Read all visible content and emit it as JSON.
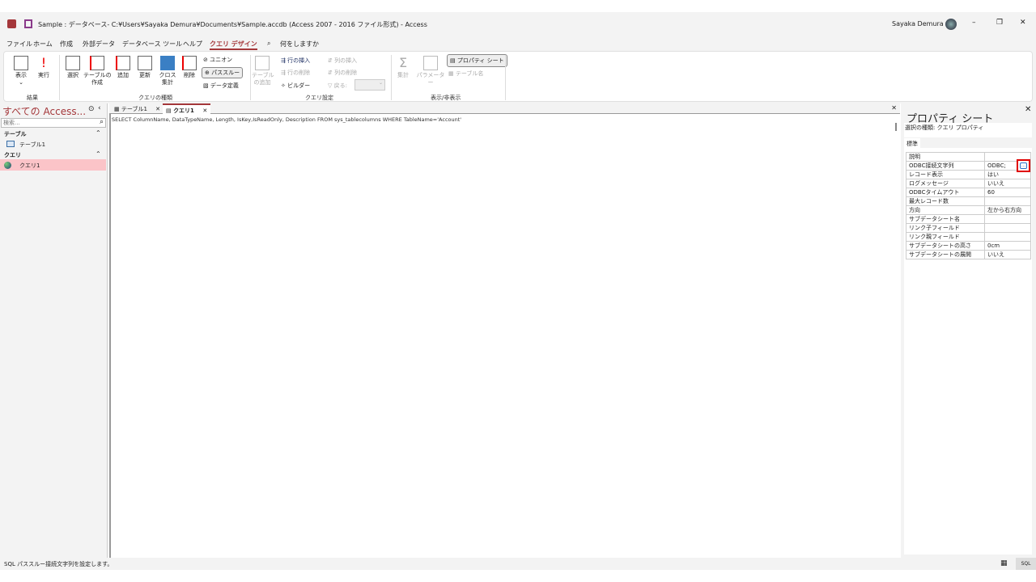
{
  "title_bar": {
    "title": "Sample : データベース- C:¥Users¥Sayaka Demura¥Documents¥Sample.accdb (Access 2007 - 2016 ファイル形式)  -  Access",
    "user": "Sayaka Demura",
    "minimize": "–",
    "restore": "❐",
    "close": "✕"
  },
  "menu": {
    "items": [
      "ファイル",
      "ホーム",
      "作成",
      "外部データ",
      "データベース ツール",
      "ヘルプ",
      "クエリ デザイン"
    ],
    "active": "クエリ デザイン",
    "search": "何をしますか"
  },
  "ribbon": {
    "results": {
      "view": "表示",
      "run": "実行",
      "group": "結果"
    },
    "query_type": {
      "select": "選択",
      "make_table": "テーブルの\n作成",
      "append": "追加",
      "update": "更新",
      "crosstab": "クロス\n集計",
      "delete": "削除",
      "union": "ユニオン",
      "pass_through": "パススルー",
      "data_definition": "データ定義",
      "group": "クエリの種類"
    },
    "query_setup": {
      "add_table": "テーブル\nの追加",
      "insert_rows": "行の挿入",
      "delete_rows": "行の削除",
      "builder": "ビルダー",
      "insert_columns": "列の挿入",
      "delete_columns": "列の削除",
      "return": "戻る:",
      "group": "クエリ設定"
    },
    "show_hide": {
      "totals": "集計",
      "parameters": "パラメーター",
      "property_sheet": "プロパティ シート",
      "table_names": "テーブル名",
      "group": "表示/非表示"
    }
  },
  "nav": {
    "title": "すべての Access...",
    "search_placeholder": "検索...",
    "sections": [
      {
        "label": "テーブル",
        "items": [
          "テーブル1"
        ]
      },
      {
        "label": "クエリ",
        "items": [
          "クエリ1"
        ]
      }
    ]
  },
  "tabs": [
    {
      "label": "テーブル1"
    },
    {
      "label": "クエリ1",
      "active": true
    }
  ],
  "sql": "SELECT ColumnName, DataTypeName, Length, IsKey,IsReadOnly, Description FROM sys_tablecolumns WHERE TableName='Account'",
  "property_sheet": {
    "title": "プロパティ シート",
    "selection_type": "選択の種類:  クエリ プロパティ",
    "tab": "標準",
    "rows": [
      {
        "name": "説明",
        "value": ""
      },
      {
        "name": "ODBC接続文字列",
        "value": "ODBC;"
      },
      {
        "name": "レコード表示",
        "value": "はい"
      },
      {
        "name": "ログメッセージ",
        "value": "いいえ"
      },
      {
        "name": "ODBCタイムアウト",
        "value": "60"
      },
      {
        "name": "最大レコード数",
        "value": ""
      },
      {
        "name": "方向",
        "value": "左から右方向"
      },
      {
        "name": "サブデータシート名",
        "value": ""
      },
      {
        "name": "リンク子フィールド",
        "value": ""
      },
      {
        "name": "リンク親フィールド",
        "value": ""
      },
      {
        "name": "サブデータシートの高さ",
        "value": "0cm"
      },
      {
        "name": "サブデータシートの展開",
        "value": "いいえ"
      }
    ],
    "builder_button": "..."
  },
  "status": {
    "text": "SQL パススルー接続文字列を設定します。",
    "sql_view": "SQL"
  },
  "colors": {
    "accent": "#a4373a",
    "highlight": "#e00000",
    "nav_selected": "#fbc4c8"
  }
}
